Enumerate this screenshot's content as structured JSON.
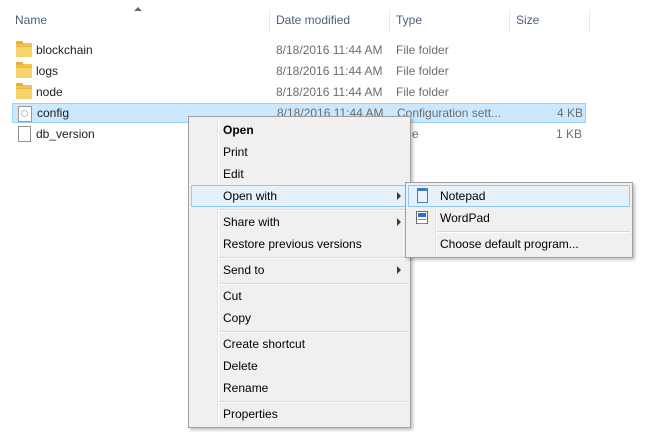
{
  "columns": {
    "name": "Name",
    "date_modified": "Date modified",
    "type": "Type",
    "size": "Size"
  },
  "files": [
    {
      "name": "blockchain",
      "date": "8/18/2016 11:44 AM",
      "type": "File folder",
      "size": "",
      "icon": "folder-icon",
      "selected": false
    },
    {
      "name": "logs",
      "date": "8/18/2016 11:44 AM",
      "type": "File folder",
      "size": "",
      "icon": "folder-icon",
      "selected": false
    },
    {
      "name": "node",
      "date": "8/18/2016 11:44 AM",
      "type": "File folder",
      "size": "",
      "icon": "folder-icon",
      "selected": false
    },
    {
      "name": "config",
      "date": "8/18/2016 11:44 AM",
      "type": "Configuration sett...",
      "size": "4 KB",
      "icon": "settings-file-icon",
      "selected": true
    },
    {
      "name": "db_version",
      "date": "",
      "type": "e",
      "size": "1 KB",
      "icon": "file-icon",
      "selected": false
    }
  ],
  "context_menu": {
    "open": "Open",
    "print": "Print",
    "edit": "Edit",
    "open_with": "Open with",
    "share_with": "Share with",
    "restore_previous_versions": "Restore previous versions",
    "send_to": "Send to",
    "cut": "Cut",
    "copy": "Copy",
    "create_shortcut": "Create shortcut",
    "delete": "Delete",
    "rename": "Rename",
    "properties": "Properties"
  },
  "open_with_menu": {
    "notepad": "Notepad",
    "wordpad": "WordPad",
    "choose_default": "Choose default program..."
  },
  "colors": {
    "selection_bg": "#cce8ff",
    "selection_border": "#99d1ff",
    "menu_bg": "#f0f0f0",
    "menu_hover_bg": "#e5f1fb",
    "menu_hover_border": "#90c8f6",
    "header_text": "#4c607a"
  }
}
